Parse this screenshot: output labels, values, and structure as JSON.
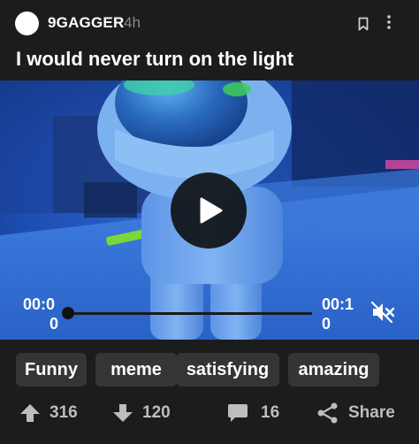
{
  "post": {
    "username": "9GAGGER",
    "time_ago": "4h",
    "title": "I would never turn on the light"
  },
  "video": {
    "current_time": "00:0\n0",
    "total_time": "00:1\n0",
    "progress_fraction": 0.0,
    "muted": true
  },
  "tags": [
    "Funny",
    "meme",
    "satisfying",
    "amazing"
  ],
  "actions": {
    "upvotes": "316",
    "downvotes": "120",
    "comments": "16",
    "share_label": "Share"
  },
  "colors": {
    "background": "#1c1c1c",
    "tag_bg": "#353535",
    "muted_text": "#8a8a8a"
  },
  "icons": [
    "bookmark-icon",
    "more-vertical-icon",
    "play-icon",
    "mute-icon",
    "upvote-arrow-icon",
    "downvote-arrow-icon",
    "comment-icon",
    "share-icon"
  ]
}
